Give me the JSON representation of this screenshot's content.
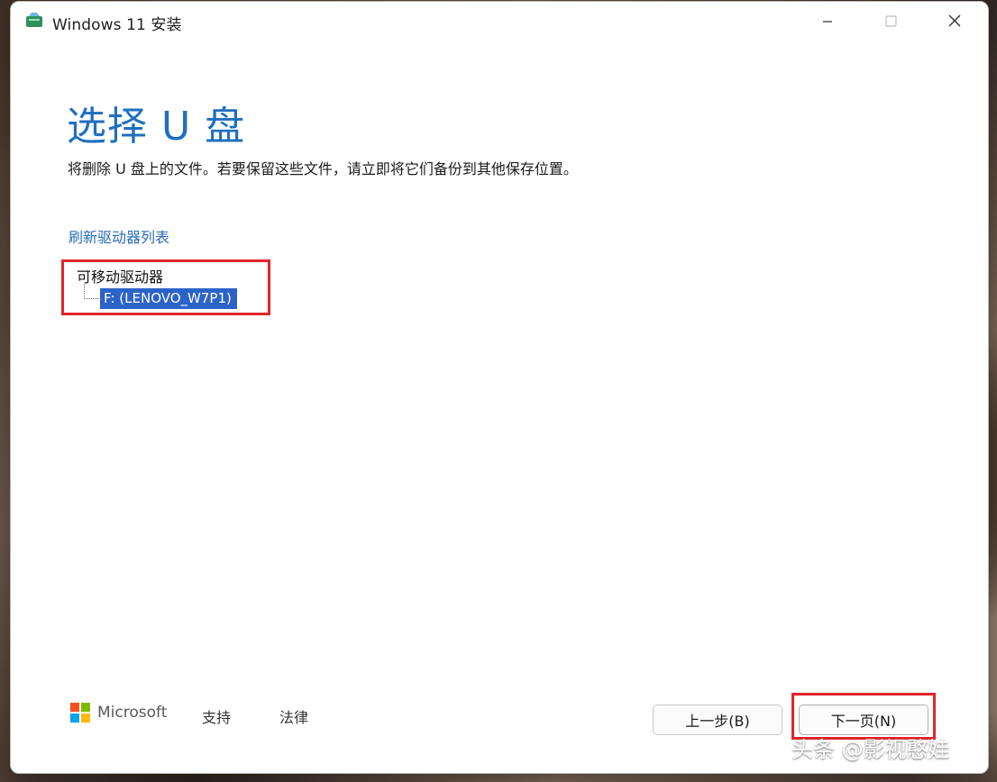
{
  "window": {
    "title": "Windows 11 安装",
    "app_icon": "windows-setup-icon",
    "controls": {
      "minimize_icon": "minimize-icon",
      "maximize_icon": "maximize-icon",
      "close_icon": "close-icon"
    }
  },
  "main": {
    "heading": "选择 U 盘",
    "subtitle": "将删除 U 盘上的文件。若要保留这些文件，请立即将它们备份到其他保存位置。",
    "refresh_link": "刷新驱动器列表",
    "drive_tree": {
      "category": "可移动驱动器",
      "items": [
        {
          "label": "F: (LENOVO_W7P1)",
          "selected": true
        }
      ]
    }
  },
  "footer": {
    "brand": "Microsoft",
    "support_link": "支持",
    "legal_link": "法律",
    "back_button": "上一步(B)",
    "next_button": "下一页(N)"
  },
  "watermark": "头条 @影视憨娃",
  "colors": {
    "heading_blue": "#1f6fbf",
    "link_blue": "#2a6db8",
    "selection_blue": "#2b63c8",
    "highlight_red": "#e0252b",
    "ms_red": "#f25022",
    "ms_green": "#7fba00",
    "ms_blue": "#00a4ef",
    "ms_yellow": "#ffb900"
  }
}
